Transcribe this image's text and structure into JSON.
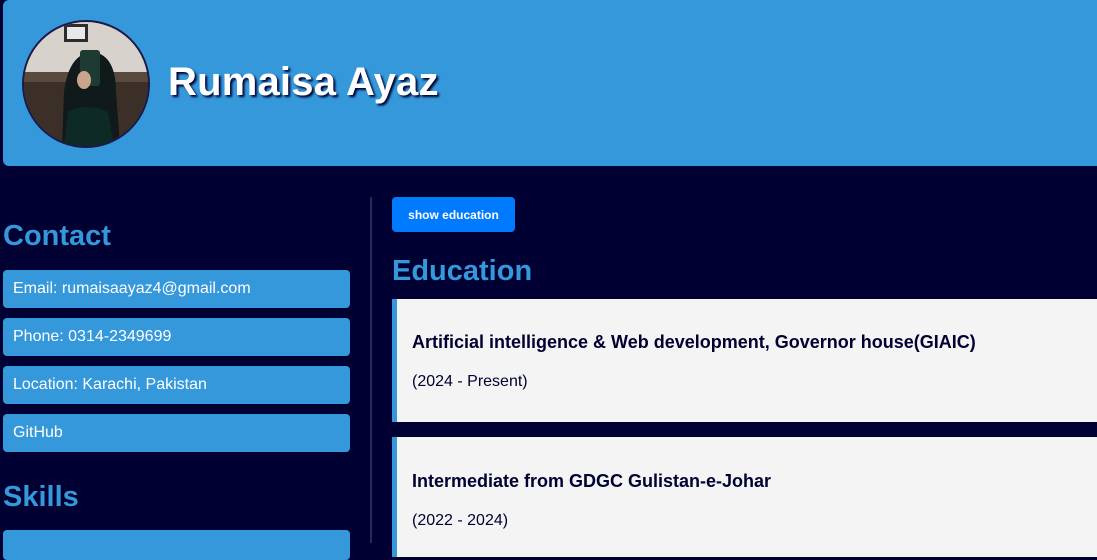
{
  "header": {
    "name": "Rumaisa Ayaz"
  },
  "contact": {
    "title": "Contact",
    "items": [
      {
        "label": "Email: rumaisaayaz4@gmail.com"
      },
      {
        "label": "Phone: 0314-2349699"
      },
      {
        "label": "Location: Karachi, Pakistan"
      },
      {
        "label": "GitHub"
      }
    ]
  },
  "skills": {
    "title": "Skills"
  },
  "education": {
    "toggle_label": "show education",
    "title": "Education",
    "entries": [
      {
        "degree": "Artificial intelligence & Web development, Governor house(GIAIC)",
        "years": "(2024 - Present)"
      },
      {
        "degree": "Intermediate from GDGC Gulistan-e-Johar",
        "years": "(2022 - 2024)"
      }
    ]
  },
  "colors": {
    "background": "#000033",
    "accent": "#3498db",
    "button": "#007bff",
    "card": "#f4f4f4"
  }
}
